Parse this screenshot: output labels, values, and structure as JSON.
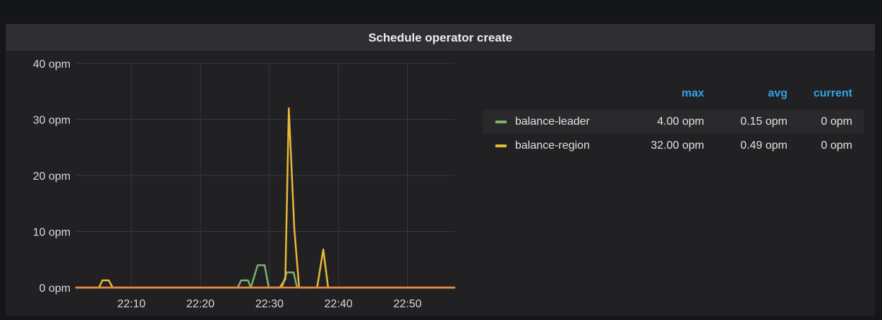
{
  "panel": {
    "title": "Schedule operator create"
  },
  "chart_data": {
    "type": "line",
    "title": "Schedule operator create",
    "x_unit": "minutes (HH:MM)",
    "x_range": [
      "22:02",
      "22:56.8"
    ],
    "xticks": [
      "22:10",
      "22:20",
      "22:30",
      "22:40",
      "22:50"
    ],
    "ylim": [
      0,
      40
    ],
    "yticks": [
      0,
      10,
      20,
      30,
      40
    ],
    "ytick_labels": [
      "0 opm",
      "10 opm",
      "20 opm",
      "30 opm",
      "40 opm"
    ],
    "grid": true,
    "legend_placement": "right",
    "series": [
      {
        "name": "balance-leader",
        "color": "#7eb26d",
        "points": [
          [
            "22:02",
            0
          ],
          [
            "22:25.4",
            0
          ],
          [
            "22:25.9",
            1.3
          ],
          [
            "22:26.9",
            1.3
          ],
          [
            "22:27.3",
            0
          ],
          [
            "22:28.3",
            4
          ],
          [
            "22:29.3",
            4
          ],
          [
            "22:29.9",
            0
          ],
          [
            "22:31.8",
            0
          ],
          [
            "22:32.5",
            2.7
          ],
          [
            "22:33.5",
            2.7
          ],
          [
            "22:34",
            0
          ],
          [
            "22:56.8",
            0
          ]
        ]
      },
      {
        "name": "balance-region",
        "color": "#eab839",
        "points": [
          [
            "22:02",
            0
          ],
          [
            "22:05.3",
            0
          ],
          [
            "22:05.8",
            1.3
          ],
          [
            "22:06.7",
            1.3
          ],
          [
            "22:07.3",
            0
          ],
          [
            "22:31.5",
            0
          ],
          [
            "22:32.3",
            1.5
          ],
          [
            "22:32.8",
            32
          ],
          [
            "22:33.6",
            10.5
          ],
          [
            "22:34.3",
            0
          ],
          [
            "22:36.9",
            0
          ],
          [
            "22:37.8",
            6.8
          ],
          [
            "22:38.5",
            0
          ],
          [
            "22:56.8",
            0
          ]
        ]
      },
      {
        "name": "",
        "color": "#ef843c",
        "points": [
          [
            "22:02",
            0
          ],
          [
            "22:56.8",
            0
          ]
        ]
      }
    ]
  },
  "legend": {
    "headers": {
      "max": "max",
      "avg": "avg",
      "current": "current"
    },
    "rows": [
      {
        "name": "balance-leader",
        "color": "#7eb26d",
        "max": "4.00 opm",
        "avg": "0.15 opm",
        "current": "0 opm"
      },
      {
        "name": "balance-region",
        "color": "#eab839",
        "max": "32.00 opm",
        "avg": "0.49 opm",
        "current": "0 opm"
      }
    ]
  }
}
